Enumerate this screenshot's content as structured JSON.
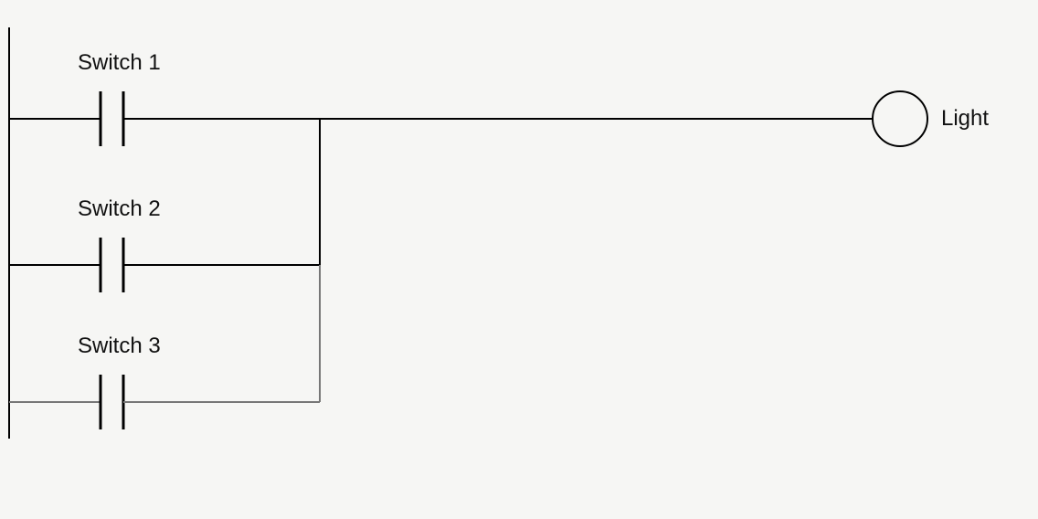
{
  "diagram": {
    "switches": [
      {
        "label": "Switch 1"
      },
      {
        "label": "Switch 2"
      },
      {
        "label": "Switch 3"
      }
    ],
    "output": {
      "label": "Light"
    }
  }
}
